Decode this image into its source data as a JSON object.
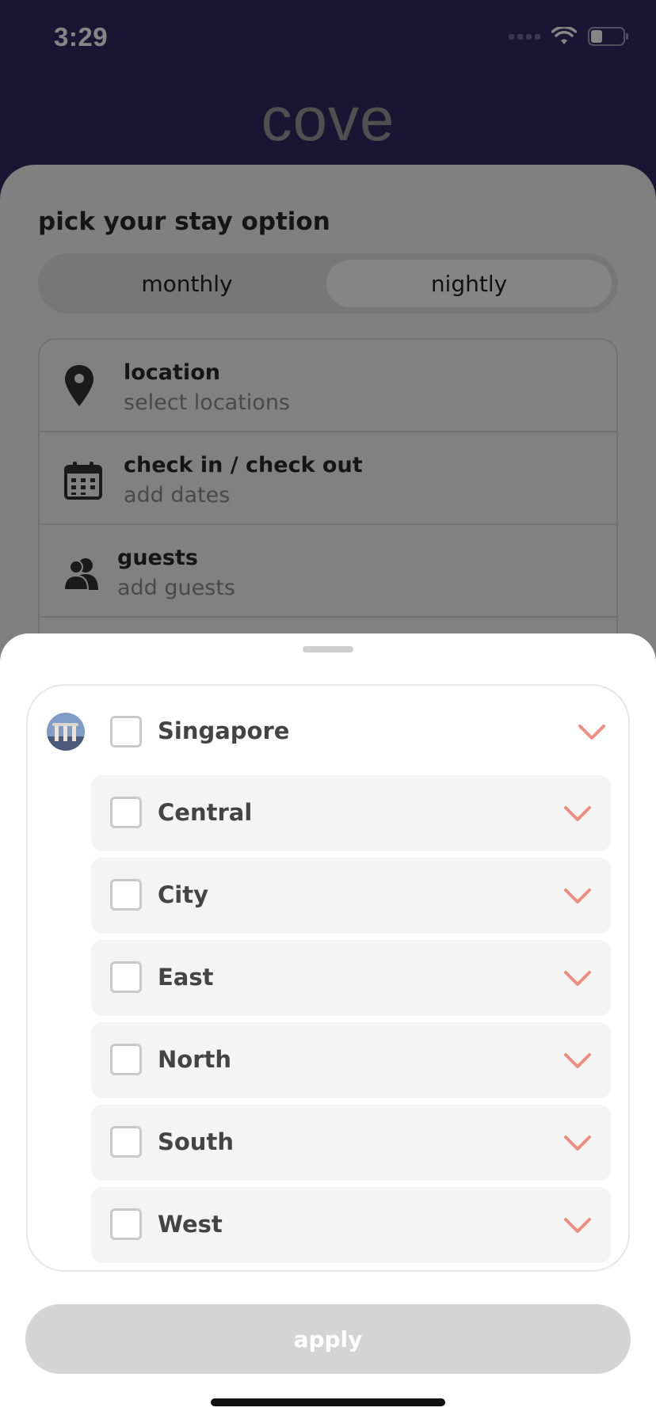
{
  "status_bar": {
    "time": "3:29",
    "icons": [
      "cellular-signal-icon",
      "wifi-icon",
      "battery-icon"
    ],
    "battery_level": 0.35
  },
  "header": {
    "logo": "cove"
  },
  "search": {
    "title": "pick your stay option",
    "stay_options": [
      "monthly",
      "nightly"
    ],
    "selected_option": "nightly",
    "fields": [
      {
        "label": "location",
        "value": "select locations",
        "icon": "location-pin-icon"
      },
      {
        "label": "check in / check out",
        "value": "add dates",
        "icon": "calendar-icon"
      },
      {
        "label": "guests",
        "value": "add guests",
        "icon": "guests-icon"
      }
    ]
  },
  "location_sheet": {
    "city": {
      "name": "Singapore",
      "checked": false,
      "icon": "singapore-skyline-avatar"
    },
    "regions": [
      {
        "name": "Central",
        "checked": false
      },
      {
        "name": "City",
        "checked": false
      },
      {
        "name": "East",
        "checked": false
      },
      {
        "name": "North",
        "checked": false
      },
      {
        "name": "South",
        "checked": false
      },
      {
        "name": "West",
        "checked": false
      }
    ],
    "apply_label": "apply"
  },
  "colors": {
    "brand_purple": "#322a63",
    "chevron_accent": "#f08d7f",
    "apply_disabled": "#d4d4d4"
  }
}
